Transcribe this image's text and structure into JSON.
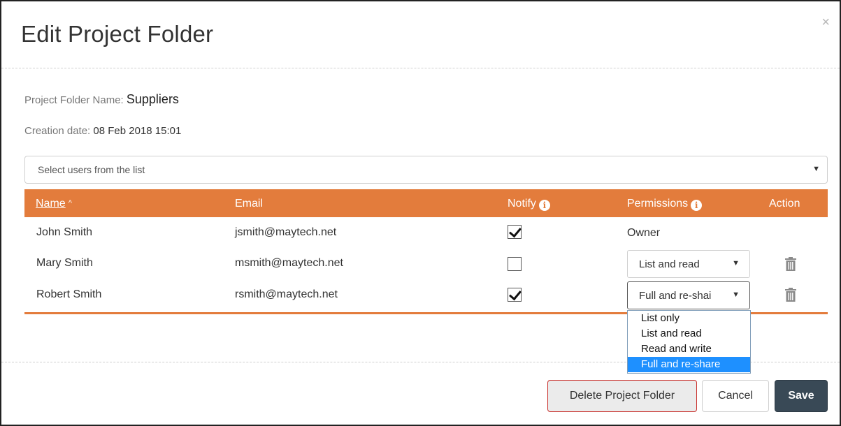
{
  "dialog": {
    "title": "Edit Project Folder",
    "close_symbol": "×"
  },
  "folder": {
    "name_label": "Project Folder Name:",
    "name_value": "Suppliers",
    "date_label": "Creation date:",
    "date_value": "08 Feb 2018 15:01"
  },
  "user_select": {
    "placeholder": "Select users from the list",
    "caret": "▼"
  },
  "table": {
    "headers": {
      "name": "Name",
      "name_sort_icon": "^",
      "email": "Email",
      "notify": "Notify",
      "permissions": "Permissions",
      "action": "Action",
      "info_icon": "i"
    },
    "rows": [
      {
        "name": "John Smith",
        "email": "jsmith@maytech.net",
        "notify": true,
        "permission": "Owner",
        "editable": false
      },
      {
        "name": "Mary Smith",
        "email": "msmith@maytech.net",
        "notify": false,
        "permission": "List and read",
        "editable": true
      },
      {
        "name": "Robert Smith",
        "email": "rsmith@maytech.net",
        "notify": true,
        "permission": "Full and re-shai",
        "editable": true
      }
    ]
  },
  "permission_dropdown": {
    "options": [
      "List only",
      "List and read",
      "Read and write",
      "Full and re-share"
    ],
    "selected_index": 3
  },
  "colors": {
    "accent": "#e37c3c",
    "save_button": "#394956",
    "delete_border": "#c9302c",
    "dropdown_selected": "#1e90ff"
  },
  "footer": {
    "delete_label": "Delete Project Folder",
    "cancel_label": "Cancel",
    "save_label": "Save"
  }
}
